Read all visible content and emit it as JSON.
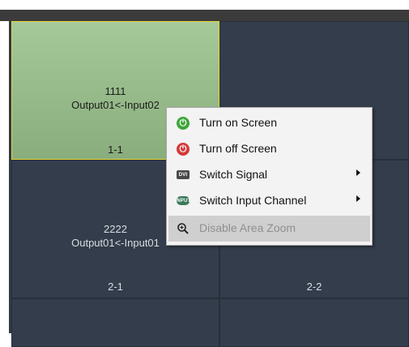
{
  "wall": {
    "cells": [
      {
        "name": "1111",
        "route": "Output01<-Input02",
        "position": "1-1",
        "selected": true
      },
      {
        "name": "",
        "route": "",
        "position": "",
        "selected": false
      },
      {
        "name": "2222",
        "route": "Output01<-Input01",
        "position": "2-1",
        "selected": false
      },
      {
        "name": "",
        "route": "",
        "position": "2-2",
        "selected": false
      }
    ]
  },
  "context_menu": {
    "items": [
      {
        "label": "Turn on Screen",
        "icon": "power-on-icon",
        "color": "#3fa63a",
        "submenu": false,
        "disabled": false
      },
      {
        "label": "Turn off Screen",
        "icon": "power-off-icon",
        "color": "#d43b3b",
        "submenu": false,
        "disabled": false
      },
      {
        "label": "Switch Signal",
        "icon": "dvi-icon",
        "submenu": true,
        "disabled": false
      },
      {
        "label": "Switch Input Channel",
        "icon": "input-channel-icon",
        "submenu": true,
        "disabled": false
      },
      {
        "label": "Disable Area Zoom",
        "icon": "zoom-icon",
        "submenu": false,
        "disabled": true
      }
    ]
  },
  "colors": {
    "selection_border": "#e8d631",
    "selected_fill": "#a6c99a",
    "cell_fill": "#333d4b"
  }
}
